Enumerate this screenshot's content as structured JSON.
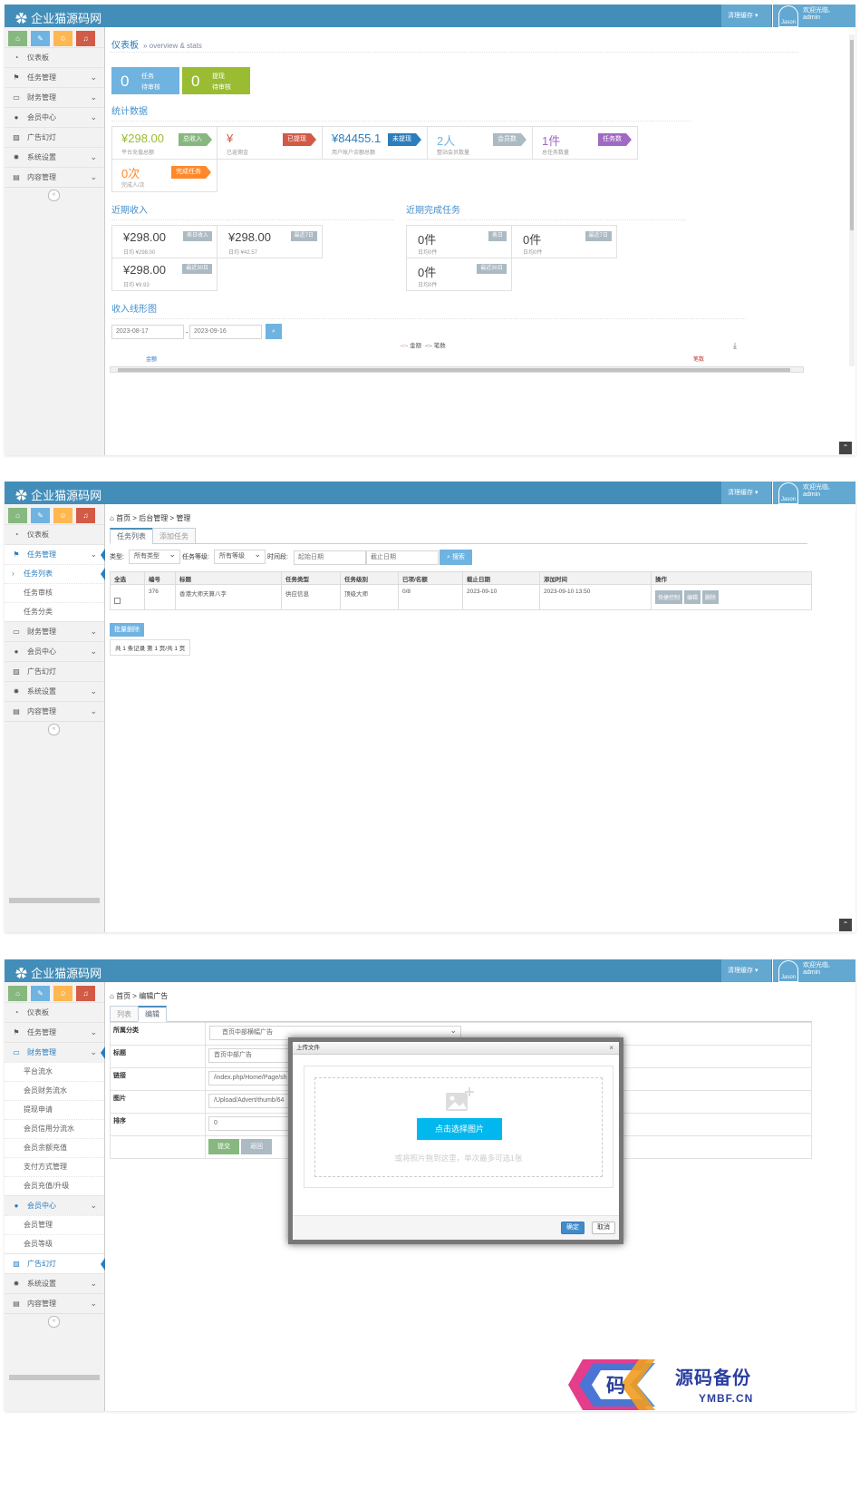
{
  "app": {
    "brand": "企业猫源码网",
    "clear_cache": "清理缓存",
    "welcome": "欢迎光临,",
    "user": "admin",
    "avatar_text": "Jason"
  },
  "shortcuts": {
    "colors": [
      "#87b87f",
      "#6fb3e0",
      "#ffb752",
      "#d15b47"
    ]
  },
  "menu": {
    "dashboard": "仪表板",
    "tasks": "任务管理",
    "finance": "财务管理",
    "members": "会员中心",
    "ads": "广告幻灯",
    "system": "系统设置",
    "content": "内容管理"
  },
  "s1": {
    "title": "仪表板",
    "subtitle": "» overview & stats",
    "box1": {
      "num": "0",
      "l1": "任务",
      "l2": "待审核",
      "color": "#6fb3e0"
    },
    "box2": {
      "num": "0",
      "l1": "提现",
      "l2": "待审核",
      "color": "#9abc32"
    },
    "stats_title": "统计数据",
    "stats": [
      {
        "value": "¥298.00",
        "desc": "平台充值总额",
        "tag": "总收入",
        "color": "#9abc32",
        "tagcolor": "#87b87f"
      },
      {
        "value": "¥",
        "desc": "已返佣金",
        "tag": "已提现",
        "color": "#d15b47",
        "tagcolor": "#d15b47"
      },
      {
        "value": "¥84455.1",
        "desc": "用户账户余额总额",
        "tag": "未提现",
        "color": "#2b7dbc",
        "tagcolor": "#2b7dbc"
      },
      {
        "value": "2人",
        "desc": "整站会员数量",
        "tag": "会员数",
        "color": "#6fb3e0",
        "tagcolor": "#abbac3"
      },
      {
        "value": "1件",
        "desc": "总任务数量",
        "tag": "任务数",
        "color": "#a069c3",
        "tagcolor": "#a069c3"
      },
      {
        "value": "0次",
        "desc": "完成人/次",
        "tag": "完成任务",
        "color": "#ff892a",
        "tagcolor": "#ff892a"
      }
    ],
    "income_title": "近期收入",
    "income": [
      {
        "v": "¥298.00",
        "t": "表日收入",
        "d": "日均 ¥298.00"
      },
      {
        "v": "¥298.00",
        "t": "最近7日",
        "d": "日均 ¥42.57"
      },
      {
        "v": "¥298.00",
        "t": "最近30日",
        "d": "日均 ¥9.93"
      }
    ],
    "done_title": "近期完成任务",
    "done": [
      {
        "v": "0件",
        "t": "表日",
        "d": "日均0件"
      },
      {
        "v": "0件",
        "t": "最近7日",
        "d": "日均0件"
      },
      {
        "v": "0件",
        "t": "最近30日",
        "d": "日均0件"
      }
    ],
    "chart_title": "收入线形图",
    "date_from": "2023-08-17",
    "date_to": "2023-09-16",
    "legend1": "金额",
    "legend2": "笔数",
    "axis_left": "金额",
    "axis_right": "笔数"
  },
  "s2": {
    "breadcrumb": [
      "首页",
      "后台管理",
      "管理"
    ],
    "tabs": [
      "任务列表",
      "添加任务"
    ],
    "f_type": "类型:",
    "f_type_sel": "所有类型",
    "f_level": "任务等级:",
    "f_level_sel": "所有等级",
    "f_time": "时间段:",
    "f_start": "起始日期",
    "f_end": "截止日期",
    "search": "搜索",
    "columns": [
      "全选",
      "编号",
      "标题",
      "任务类型",
      "任务级别",
      "已项/名额",
      "截止日期",
      "添加时间",
      "操作"
    ],
    "row": {
      "id": "376",
      "title": "香港大师天算八字",
      "type": "供应信息",
      "level": "顶级大师",
      "quota": "0/8",
      "deadline": "2023-09-10",
      "added": "2023-09-10 13:50",
      "ops": [
        "快捷控制",
        "编辑",
        "删除"
      ]
    },
    "batch_delete": "批量删除",
    "pagination": "共 1 条记录 第 1 页/共 1 页",
    "sub_menu": [
      "任务列表",
      "任务审核",
      "任务分类"
    ]
  },
  "s3": {
    "breadcrumb": [
      "首页",
      "编辑广告"
    ],
    "tabs": [
      "列表",
      "编辑"
    ],
    "fields": [
      {
        "k": "所属分类",
        "v": "首页中部横幅广告"
      },
      {
        "k": "标题",
        "v": "首页中部广告"
      },
      {
        "k": "链接",
        "v": "/index.php/Home/Page/sh"
      },
      {
        "k": "图片",
        "v": "/Upload/Advert/thumb/64"
      },
      {
        "k": "排序",
        "v": "0"
      }
    ],
    "submit": "提交",
    "back": "返回",
    "finance_sub": [
      "平台流水",
      "会员财务流水",
      "提现申请",
      "会员信用分流水",
      "会员余额充值",
      "支付方式管理",
      "会员充值/升级"
    ],
    "member_sub": [
      "会员管理",
      "会员等级"
    ],
    "modal": {
      "title": "上传文件",
      "choose": "点击选择图片",
      "hint": "或将照片拖到这里，单次最多可选1张",
      "ok": "确定",
      "cancel": "取消"
    }
  },
  "watermark": {
    "char": "码",
    "name": "源码备份",
    "domain": "YMBF.CN"
  }
}
